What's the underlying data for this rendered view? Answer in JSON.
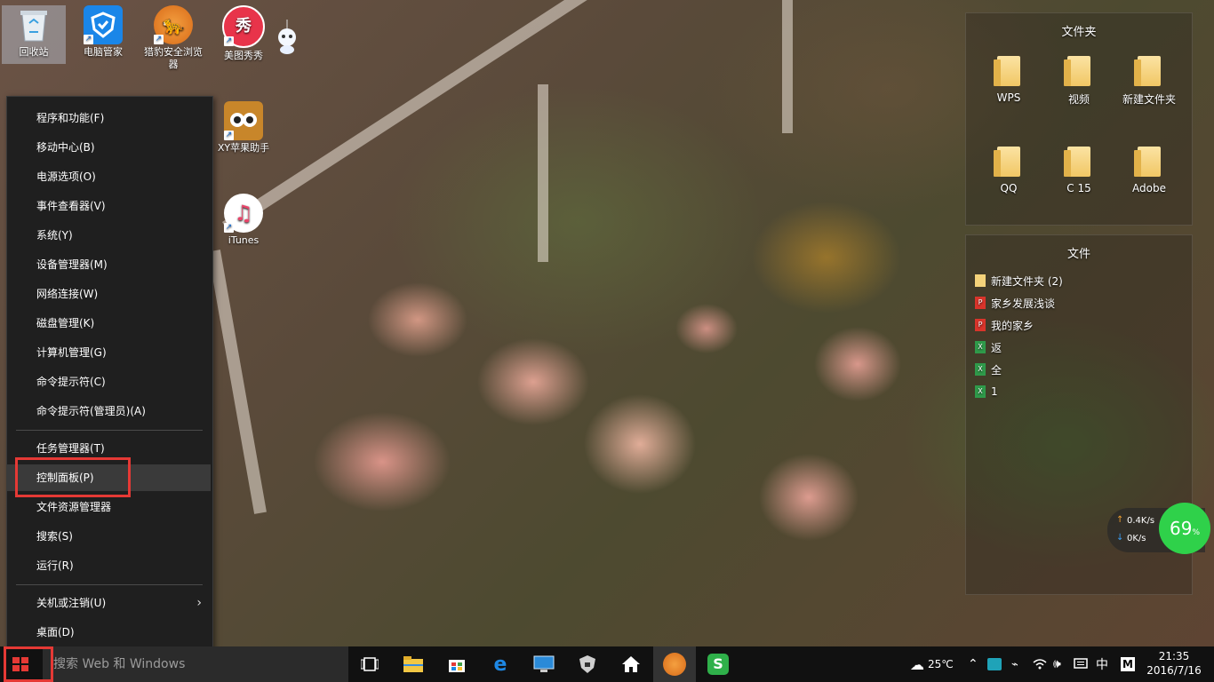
{
  "desktop_icons": [
    {
      "label": "回收站",
      "icon": "recycle-bin-icon"
    },
    {
      "label": "电脑管家",
      "icon": "shield-icon"
    },
    {
      "label": "猎豹安全浏览器",
      "icon": "browser-icon"
    },
    {
      "label": "美图秀秀",
      "icon": "meitu-icon"
    },
    {
      "label": "XY苹果助手",
      "icon": "owl-icon"
    },
    {
      "label": "iTunes",
      "icon": "music-note-icon"
    }
  ],
  "fence_folders": {
    "title": "文件夹",
    "items": [
      "WPS",
      "视频",
      "新建文件夹",
      "QQ",
      "C 15",
      "Adobe"
    ]
  },
  "fence_files": {
    "title": "文件",
    "items": [
      {
        "label": "新建文件夹 (2)",
        "icon": "folder-icon"
      },
      {
        "label": "家乡发展浅谈",
        "icon": "pdf-icon"
      },
      {
        "label": "我的家乡",
        "icon": "pdf-icon"
      },
      {
        "label": "返",
        "icon": "excel-icon"
      },
      {
        "label": "全",
        "icon": "excel-icon"
      },
      {
        "label": "1",
        "icon": "excel-icon"
      }
    ]
  },
  "winx_menu": {
    "group1": [
      "程序和功能(F)",
      "移动中心(B)",
      "电源选项(O)",
      "事件查看器(V)",
      "系统(Y)",
      "设备管理器(M)",
      "网络连接(W)",
      "磁盘管理(K)",
      "计算机管理(G)",
      "命令提示符(C)",
      "命令提示符(管理员)(A)"
    ],
    "group2": [
      "任务管理器(T)",
      "控制面板(P)",
      "文件资源管理器",
      "搜索(S)",
      "运行(R)"
    ],
    "group3": [
      "关机或注销(U)",
      "桌面(D)"
    ],
    "highlighted": "控制面板(P)"
  },
  "taskbar": {
    "search_placeholder": "搜索 Web 和 Windows",
    "weather": "25℃",
    "ime": "中",
    "ime_mode": "M",
    "time": "21:35",
    "date": "2016/7/16"
  },
  "net_monitor": {
    "up": "0.4K/s",
    "down": "0K/s",
    "percent": "69",
    "percent_sign": "%"
  }
}
